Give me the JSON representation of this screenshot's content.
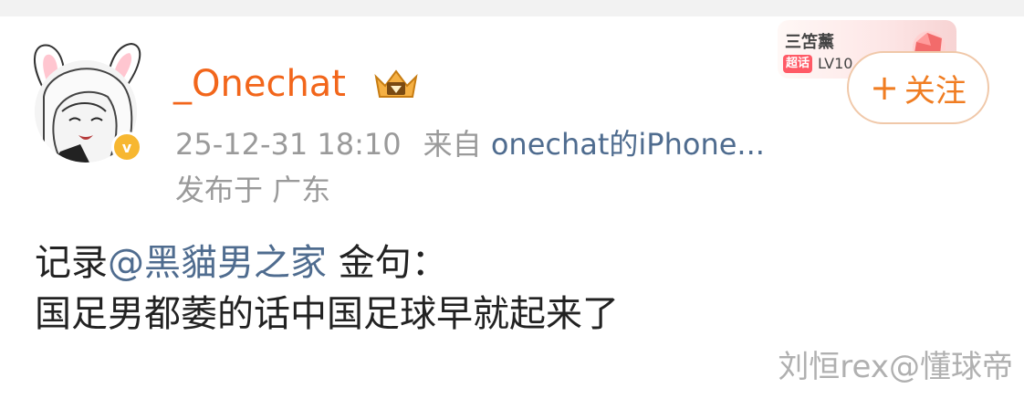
{
  "post": {
    "username": "_Onechat",
    "timestamp": "25-12-31 18:10",
    "source_prefix": "来自",
    "source": "onechat的iPhone...",
    "location": "发布于 广东",
    "text_prefix": "记录",
    "mention": "@黑貓男之家",
    "text_suffix": " 金句：",
    "text_line2": "国足男都萎的话中国足球早就起来了"
  },
  "follow": {
    "plus": "+",
    "label": "关注"
  },
  "fan_badge": {
    "title": "三笘薰",
    "tag": "超话",
    "level": "LV10"
  },
  "verified_badge": {
    "glyph": "v"
  },
  "watermark": "刘恒rex@懂球帝",
  "colors": {
    "username": "#f2661b",
    "link": "#4f6c8f",
    "follow": "#f07d22",
    "meta": "#9a9a9a",
    "verified": "#f7b731"
  }
}
